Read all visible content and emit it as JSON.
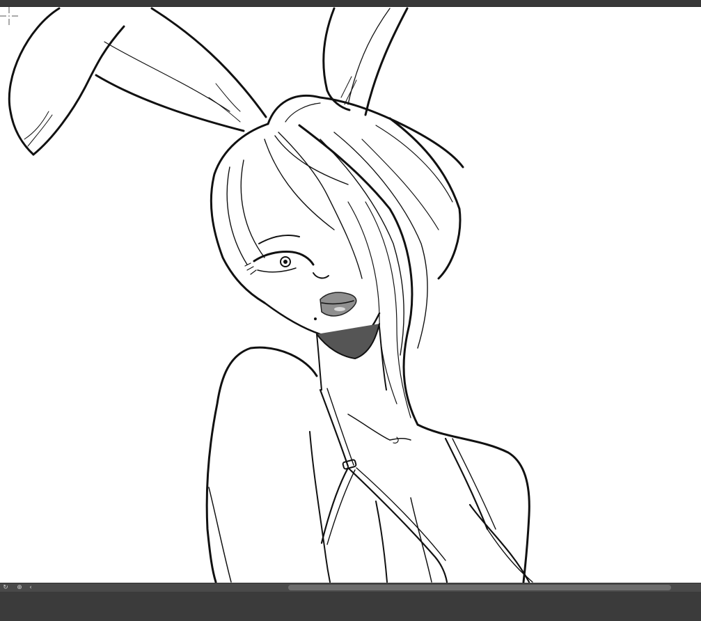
{
  "app": {
    "name": "drawing canvas"
  },
  "canvas": {
    "background": "#ffffff",
    "line_color": "#111111",
    "lip_color": "#8f8f8f",
    "artwork": "bunny-girl-sketch"
  },
  "cursor": {
    "icon": "crosshair-icon"
  },
  "statusbar": {
    "rotate_icon": "rotate-icon",
    "rotate_glyph": "↻",
    "reset_icon": "reset-view-icon",
    "reset_glyph": "⊕",
    "collapse_icon": "chevron-left-icon",
    "collapse_glyph": "‹"
  },
  "colors": {
    "chrome_dark": "#3c3c3c",
    "statusbar": "#4a4a4a",
    "scroll_thumb": "#6d6d6d"
  }
}
